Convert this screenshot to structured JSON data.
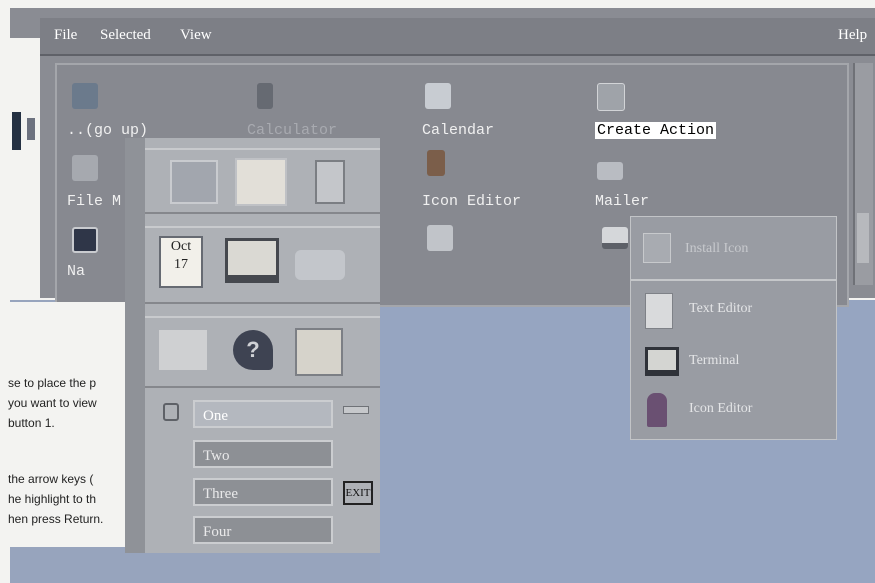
{
  "menubar": {
    "file": "File",
    "selected": "Selected",
    "view": "View",
    "help": "Help"
  },
  "file_manager": {
    "items": [
      {
        "label": "..(go up)"
      },
      {
        "label": "Calculator"
      },
      {
        "label": "Calendar"
      },
      {
        "label": "Create Action",
        "selected": true
      },
      {
        "label": "File M"
      },
      {
        "label": "Icon Editor"
      },
      {
        "label": "Mailer"
      },
      {
        "label": "Na"
      }
    ]
  },
  "front_panel": {
    "date_icon": {
      "month": "Oct",
      "day": "17"
    },
    "workspaces": [
      "One",
      "Two",
      "Three",
      "Four"
    ],
    "exit_label": "EXIT"
  },
  "subpanel": {
    "title": "Install Icon",
    "items": [
      {
        "label": "Text Editor",
        "icon": "text-editor-icon"
      },
      {
        "label": "Terminal",
        "icon": "terminal-icon"
      },
      {
        "label": "Icon Editor",
        "icon": "icon-editor-icon"
      }
    ]
  },
  "document_text": [
    "se to place the p",
    " you want to view",
    "button 1.",
    "the arrow keys (",
    "he highlight to th",
    "hen press Return."
  ],
  "colors": {
    "desktop": "#97a4bd",
    "panel": "#aeb1b6",
    "window": "#878990"
  }
}
